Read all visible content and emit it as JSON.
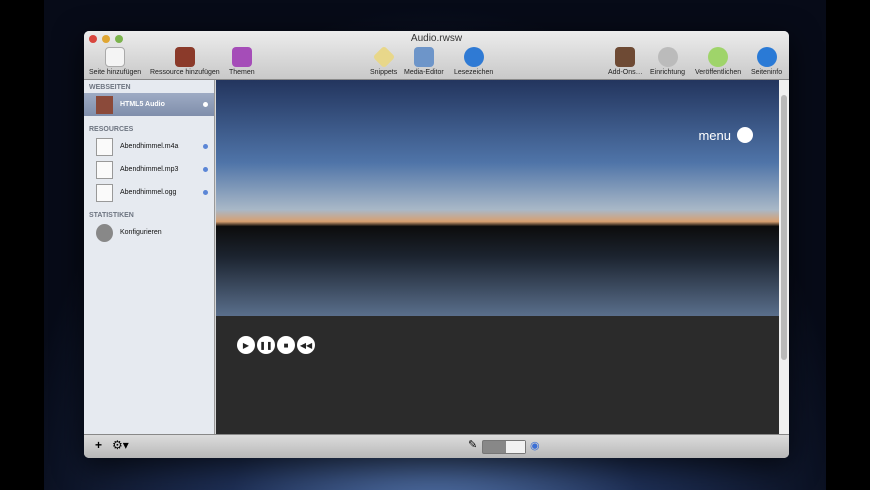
{
  "window": {
    "title": "Audio.rwsw"
  },
  "toolbar": {
    "left": [
      "Seite hinzufügen",
      "Ressource hinzufügen",
      "Themen"
    ],
    "center": [
      "Snippets",
      "Media-Editor",
      "Lesezeichen"
    ],
    "right": [
      "Add-Ons…",
      "Einrichtung",
      "Veröffentlichen",
      "Seiteninfo"
    ]
  },
  "sidebar": {
    "webseiten": "WEBSEITEN",
    "page": "HTML5 Audio",
    "resources": "RESOURCES",
    "files": [
      "Abendhimmel.m4a",
      "Abendhimmel.mp3",
      "Abendhimmel.ogg"
    ],
    "statistiken": "STATISTIKEN",
    "config": "Konfigurieren"
  },
  "preview": {
    "menu": "menu"
  }
}
